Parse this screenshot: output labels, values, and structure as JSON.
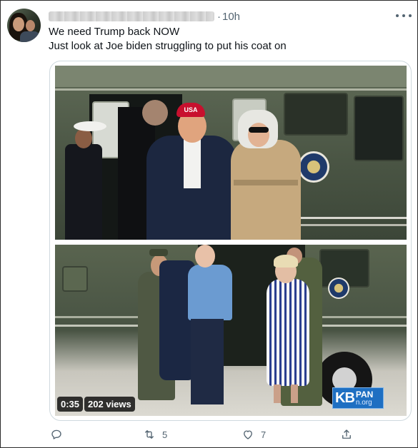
{
  "tweet": {
    "author_name_blurred": true,
    "separator": "·",
    "time": "10h",
    "text_lines": [
      "We need Trump back NOW",
      "Just look at Joe biden struggling to put his coat on"
    ]
  },
  "media": {
    "panel_top": {
      "subject": "Trump and Melania exiting Marine One",
      "cap_text": "USA"
    },
    "panel_bottom": {
      "subject": "Biden putting on coat next to Jill Biden by helicopter"
    },
    "video": {
      "duration": "0:35",
      "views": "202 views"
    },
    "watermark": {
      "big": "KB",
      "top": "PAN",
      "url": "n.org"
    }
  },
  "actions": {
    "reply_count": "",
    "retweet_count": "5",
    "like_count": "7",
    "share_count": ""
  },
  "icons": {
    "more": "more-dots-icon",
    "reply": "reply-icon",
    "retweet": "retweet-icon",
    "like": "heart-icon",
    "share": "share-icon"
  },
  "colors": {
    "text": "#0f1419",
    "secondary": "#536471",
    "media_border": "#cfd9de"
  }
}
